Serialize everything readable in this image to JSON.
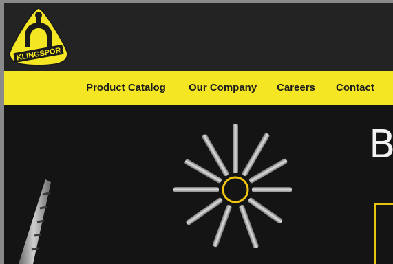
{
  "brand": {
    "name": "KLINGSPOR",
    "accent": "#f5e624",
    "dark": "#1b1b1b"
  },
  "nav": {
    "items": [
      {
        "label": "Product Catalog"
      },
      {
        "label": "Our Company"
      },
      {
        "label": "Careers"
      },
      {
        "label": "Contact"
      }
    ]
  },
  "hero": {
    "title": "B",
    "image": "radial-tools-image"
  }
}
